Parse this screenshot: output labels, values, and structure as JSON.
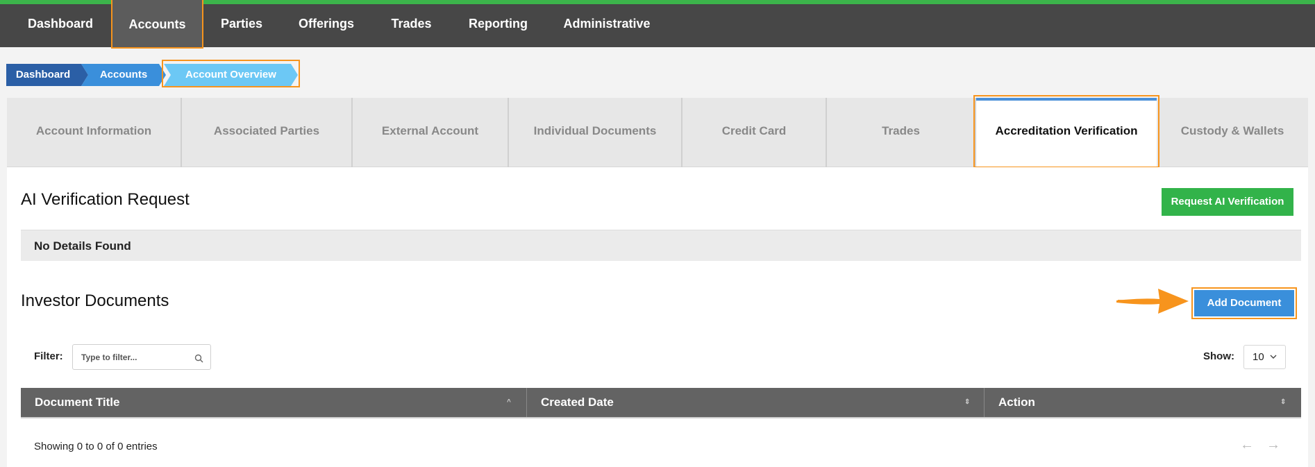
{
  "nav": {
    "items": [
      {
        "label": "Dashboard"
      },
      {
        "label": "Accounts"
      },
      {
        "label": "Parties"
      },
      {
        "label": "Offerings"
      },
      {
        "label": "Trades"
      },
      {
        "label": "Reporting"
      },
      {
        "label": "Administrative"
      }
    ]
  },
  "breadcrumb": {
    "items": [
      {
        "label": "Dashboard"
      },
      {
        "label": "Accounts"
      },
      {
        "label": "Account Overview"
      }
    ]
  },
  "tabs": [
    {
      "label": "Account Information"
    },
    {
      "label": "Associated Parties"
    },
    {
      "label": "External Account"
    },
    {
      "label": "Individual Documents"
    },
    {
      "label": "Credit Card"
    },
    {
      "label": "Trades"
    },
    {
      "label": "Accreditation Verification"
    },
    {
      "label": "Custody & Wallets"
    }
  ],
  "ai_section": {
    "title": "AI Verification Request",
    "button": "Request AI Verification",
    "empty": "No Details Found"
  },
  "docs_section": {
    "title": "Investor Documents",
    "add_button": "Add Document",
    "filter_label": "Filter:",
    "filter_placeholder": "Type to filter...",
    "show_label": "Show:",
    "show_value": "10",
    "columns": [
      "Document Title",
      "Created Date",
      "Action"
    ],
    "sort_indicators": [
      "^",
      "⇕",
      "⇕"
    ],
    "info": "Showing 0 to 0 of 0 entries",
    "prev": "←",
    "next": "→"
  },
  "colors": {
    "accent_green": "#32b34a",
    "accent_blue": "#3a8fdb",
    "highlight_orange": "#f7941d",
    "topbar": "#474747"
  }
}
